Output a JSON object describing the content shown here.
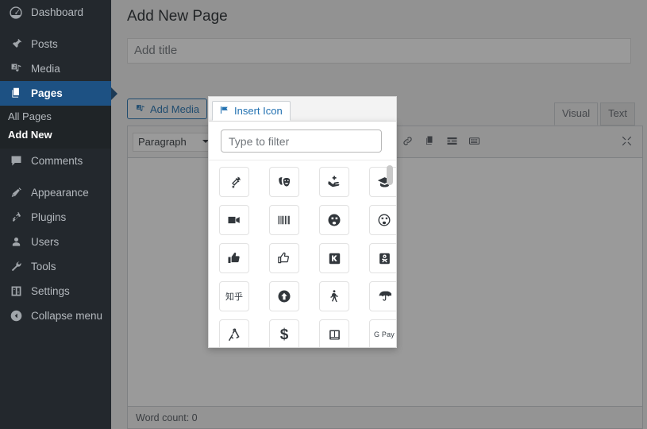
{
  "sidebar": {
    "items": [
      {
        "label": "Dashboard",
        "icon": "dashboard-icon",
        "current": false
      },
      {
        "label": "Posts",
        "icon": "pin-icon",
        "current": false
      },
      {
        "label": "Media",
        "icon": "media-icon",
        "current": false
      },
      {
        "label": "Pages",
        "icon": "pages-icon",
        "current": true
      },
      {
        "label": "Comments",
        "icon": "comments-icon",
        "current": false
      },
      {
        "label": "Appearance",
        "icon": "appearance-brush-icon",
        "current": false
      },
      {
        "label": "Plugins",
        "icon": "plugin-icon",
        "current": false
      },
      {
        "label": "Users",
        "icon": "user-icon",
        "current": false
      },
      {
        "label": "Tools",
        "icon": "wrench-icon",
        "current": false
      },
      {
        "label": "Settings",
        "icon": "settings-sliders-icon",
        "current": false
      }
    ],
    "submenu": [
      {
        "label": "All Pages",
        "current": false
      },
      {
        "label": "Add New",
        "current": true
      }
    ],
    "collapse": {
      "label": "Collapse menu",
      "icon": "collapse-arrow-icon"
    }
  },
  "page": {
    "title": "Add New Page",
    "title_input_value": "",
    "title_input_placeholder": "Add title"
  },
  "editor": {
    "add_media_label": "Add Media",
    "add_media_icon": "media-icon",
    "insert_icon_label": "Insert Icon",
    "insert_icon_glyph": "flag-icon",
    "tabs": [
      {
        "label": "Visual",
        "active": true
      },
      {
        "label": "Text",
        "active": false
      }
    ],
    "format_select_value": "Paragraph",
    "toolbar_icons": [
      "link-icon",
      "copy-icon",
      "insert-read-more-icon",
      "keyboard-icon"
    ],
    "kitchen_sink_icon": "fullscreen-icon",
    "status": "Word count: 0"
  },
  "icon_picker": {
    "filter_value": "",
    "filter_placeholder": "Type to filter",
    "scroll_position": "top",
    "icons": [
      {
        "name": "syringe-icon",
        "glyph": "syringe"
      },
      {
        "name": "theater-masks-icon",
        "glyph": "masks"
      },
      {
        "name": "hand-holding-medical-icon",
        "glyph": "hand-medical"
      },
      {
        "name": "graduation-cap-icon",
        "glyph": "graduation-cap"
      },
      {
        "name": "video-camera-icon",
        "glyph": "video"
      },
      {
        "name": "barcode-icon",
        "glyph": "barcode"
      },
      {
        "name": "dizzy-face-solid-icon",
        "glyph": "dizzy-solid"
      },
      {
        "name": "dizzy-face-outline-icon",
        "glyph": "dizzy-outline"
      },
      {
        "name": "thumbs-up-solid-icon",
        "glyph": "thumbs-up-solid"
      },
      {
        "name": "thumbs-up-outline-icon",
        "glyph": "thumbs-up-outline"
      },
      {
        "name": "kickstarter-k-icon",
        "glyph": "kickstarter-k"
      },
      {
        "name": "odnoklassniki-square-icon",
        "glyph": "odnoklassniki"
      },
      {
        "name": "zhihu-icon",
        "glyph": "text",
        "text": "知乎"
      },
      {
        "name": "arrow-up-circle-icon",
        "glyph": "arrow-circle-up"
      },
      {
        "name": "walking-icon",
        "glyph": "walking"
      },
      {
        "name": "umbrella-icon",
        "glyph": "umbrella"
      },
      {
        "name": "drafting-compass-icon",
        "glyph": "drafting-compass"
      },
      {
        "name": "dollar-sign-icon",
        "glyph": "dollar",
        "text": "$"
      },
      {
        "name": "book-reader-icon",
        "glyph": "book-square"
      },
      {
        "name": "google-pay-icon",
        "glyph": "gpay",
        "text": "G Pay"
      }
    ]
  },
  "colors": {
    "sidebar_bg": "#23282d",
    "sidebar_current": "#1d5183",
    "accent_blue": "#2271b1",
    "page_bg": "#f1f1f1",
    "overlay": "rgba(30,30,30,0.45)"
  }
}
